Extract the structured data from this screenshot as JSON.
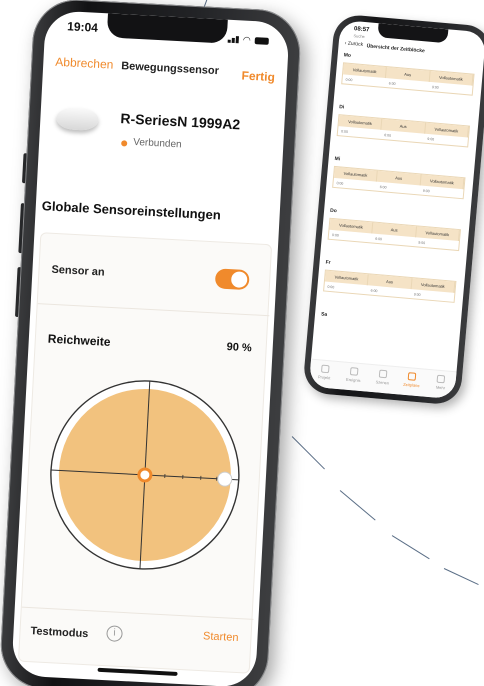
{
  "main_phone": {
    "status_bar": {
      "time": "19:04"
    },
    "nav": {
      "cancel": "Abbrechen",
      "title": "Bewegungssensor",
      "done": "Fertig"
    },
    "device": {
      "name": "R-SeriesN 1999A2",
      "status": "Verbunden"
    },
    "section_title": "Globale Sensoreinstellungen",
    "sensor": {
      "label": "Sensor an",
      "enabled": true
    },
    "range": {
      "label": "Reichweite",
      "value_text": "90 %",
      "value_percent": 90
    },
    "test": {
      "label": "Testmodus",
      "info": "i",
      "start": "Starten"
    }
  },
  "second_phone": {
    "status_bar": {
      "time": "08:57",
      "sub": "Suche"
    },
    "nav": {
      "back": "Zurück",
      "title": "Übersicht der Zeitblöcke"
    },
    "columns": [
      "Vollautomatik",
      "Aus",
      "Vollautomatik"
    ],
    "days": [
      {
        "name": "Mo",
        "times": [
          "0:00",
          "6:00",
          "9:00"
        ]
      },
      {
        "name": "Di",
        "times": [
          "0:00",
          "6:00",
          "9:00"
        ]
      },
      {
        "name": "Mi",
        "times": [
          "0:00",
          "6:00",
          "9:00"
        ]
      },
      {
        "name": "Do",
        "times": [
          "0:00",
          "6:00",
          "9:00"
        ]
      },
      {
        "name": "Fr",
        "times": [
          "0:00",
          "6:00",
          "9:00"
        ]
      },
      {
        "name": "Sa",
        "times": []
      }
    ],
    "tabbar": [
      "Projekt",
      "Ereignis",
      "Szenen",
      "Zeitpläne",
      "Mehr"
    ],
    "active_tab": 3
  },
  "colors": {
    "accent": "#f08a2c",
    "range_fill": "#f2c27e",
    "row_header": "#f5e3c6"
  }
}
